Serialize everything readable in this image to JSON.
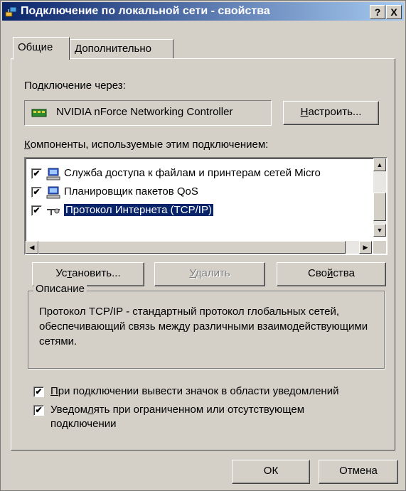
{
  "window": {
    "title": "Подключение по локальной сети - свойства",
    "help_btn": "?",
    "close_btn": "X"
  },
  "tabs": [
    {
      "label": "Общие",
      "active": true
    },
    {
      "label": "Дополнительно",
      "active": false
    }
  ],
  "connect_via": {
    "label": "Подключение через:",
    "adapter": "NVIDIA nForce Networking Controller",
    "configure_prefix": "",
    "configure_u": "Н",
    "configure_rest": "астроить..."
  },
  "components": {
    "label_u": "К",
    "label_rest": "омпоненты, используемые этим подключением:",
    "items": [
      {
        "label": "Служба доступа к файлам и принтерам сетей Micro",
        "checked": true,
        "selected": false,
        "icon": "network-service-icon"
      },
      {
        "label": "Планировщик пакетов QoS",
        "checked": true,
        "selected": false,
        "icon": "network-service-icon"
      },
      {
        "label": "Протокол Интернета (TCP/IP)",
        "checked": true,
        "selected": true,
        "icon": "protocol-icon"
      }
    ]
  },
  "buttons": {
    "install_a": "Ус",
    "install_u": "т",
    "install_b": "ановить...",
    "remove_u": "У",
    "remove_b": "далить",
    "props_a": "Сво",
    "props_u": "й",
    "props_b": "ства"
  },
  "description": {
    "title": "Описание",
    "text": "Протокол TCP/IP - стандартный протокол глобальных сетей, обеспечивающий связь между различными взаимодействующими сетями."
  },
  "options": [
    {
      "u": "П",
      "rest": "ри подключении вывести значок в области уведомлений",
      "checked": true
    },
    {
      "pre": "Уведом",
      "u": "л",
      "rest": "ять при ограниченном или отсутствующем подключении",
      "checked": true
    }
  ],
  "footer": {
    "ok": "ОК",
    "cancel": "Отмена"
  },
  "colors": {
    "title_start": "#0a246a",
    "title_end": "#a6caf0",
    "face": "#d4d0c8",
    "selection": "#0a246a"
  }
}
